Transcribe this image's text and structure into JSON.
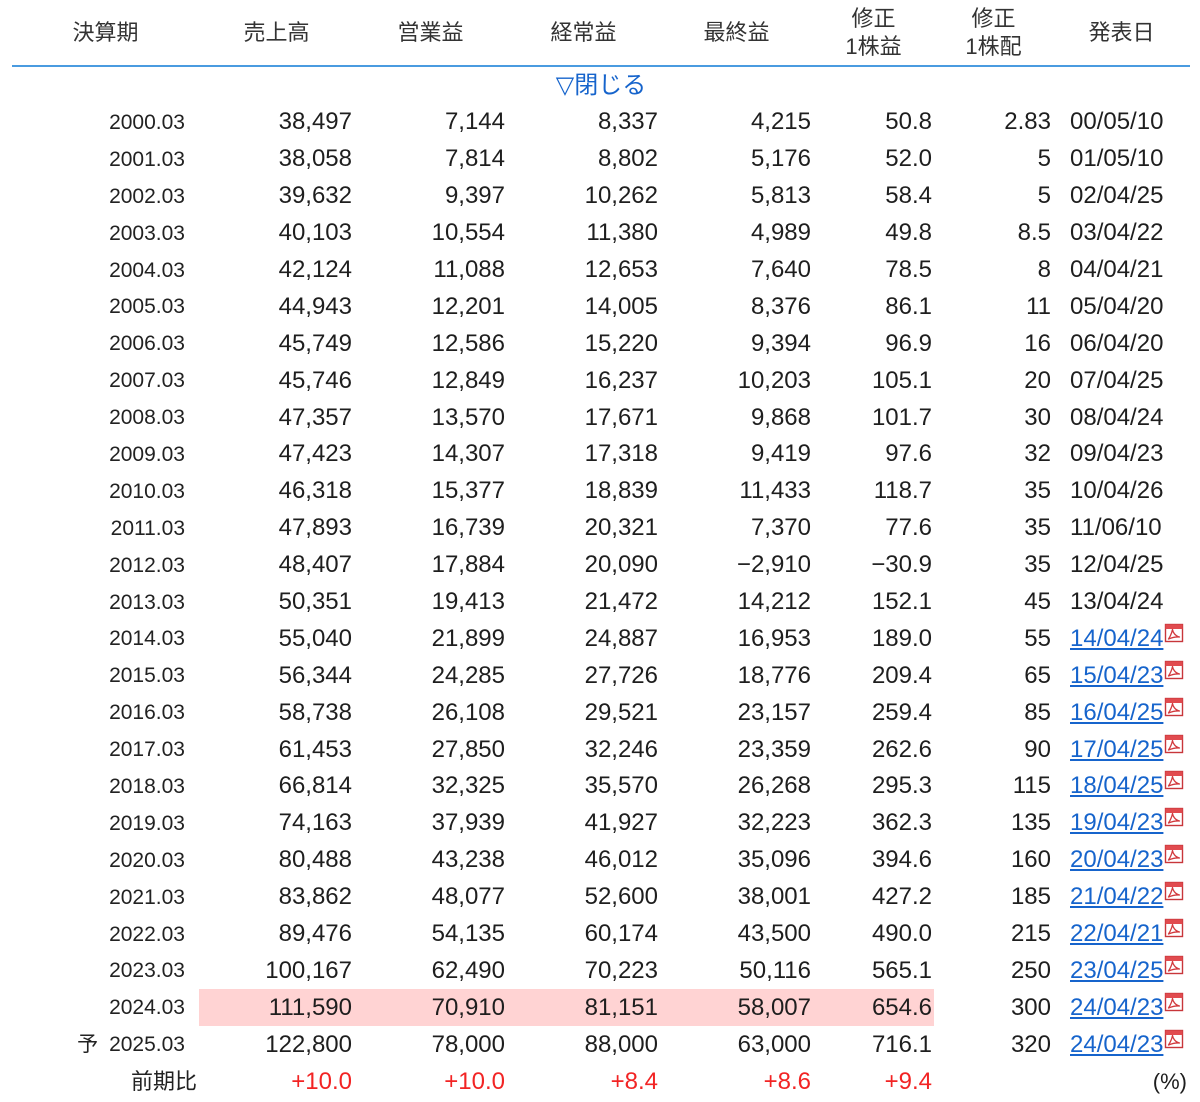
{
  "header": {
    "period": "決算期",
    "sales": "売上高",
    "operating": "営業益",
    "ordinary": "経常益",
    "net": "最終益",
    "eps": {
      "line1": "修正",
      "line2": "1株益"
    },
    "dps": {
      "line1": "修正",
      "line2": "1株配"
    },
    "date": "発表日"
  },
  "toggle": {
    "label": "▽閉じる"
  },
  "rows": [
    {
      "period": "2000.03",
      "sales": "38,497",
      "operating": "7,144",
      "ordinary": "8,337",
      "net": "4,215",
      "eps": "50.8",
      "dps": "2.83",
      "date": "00/05/10",
      "date_link": false
    },
    {
      "period": "2001.03",
      "sales": "38,058",
      "operating": "7,814",
      "ordinary": "8,802",
      "net": "5,176",
      "eps": "52.0",
      "dps": "5",
      "date": "01/05/10",
      "date_link": false
    },
    {
      "period": "2002.03",
      "sales": "39,632",
      "operating": "9,397",
      "ordinary": "10,262",
      "net": "5,813",
      "eps": "58.4",
      "dps": "5",
      "date": "02/04/25",
      "date_link": false
    },
    {
      "period": "2003.03",
      "sales": "40,103",
      "operating": "10,554",
      "ordinary": "11,380",
      "net": "4,989",
      "eps": "49.8",
      "dps": "8.5",
      "date": "03/04/22",
      "date_link": false
    },
    {
      "period": "2004.03",
      "sales": "42,124",
      "operating": "11,088",
      "ordinary": "12,653",
      "net": "7,640",
      "eps": "78.5",
      "dps": "8",
      "date": "04/04/21",
      "date_link": false
    },
    {
      "period": "2005.03",
      "sales": "44,943",
      "operating": "12,201",
      "ordinary": "14,005",
      "net": "8,376",
      "eps": "86.1",
      "dps": "11",
      "date": "05/04/20",
      "date_link": false
    },
    {
      "period": "2006.03",
      "sales": "45,749",
      "operating": "12,586",
      "ordinary": "15,220",
      "net": "9,394",
      "eps": "96.9",
      "dps": "16",
      "date": "06/04/20",
      "date_link": false
    },
    {
      "period": "2007.03",
      "sales": "45,746",
      "operating": "12,849",
      "ordinary": "16,237",
      "net": "10,203",
      "eps": "105.1",
      "dps": "20",
      "date": "07/04/25",
      "date_link": false
    },
    {
      "period": "2008.03",
      "sales": "47,357",
      "operating": "13,570",
      "ordinary": "17,671",
      "net": "9,868",
      "eps": "101.7",
      "dps": "30",
      "date": "08/04/24",
      "date_link": false
    },
    {
      "period": "2009.03",
      "sales": "47,423",
      "operating": "14,307",
      "ordinary": "17,318",
      "net": "9,419",
      "eps": "97.6",
      "dps": "32",
      "date": "09/04/23",
      "date_link": false
    },
    {
      "period": "2010.03",
      "sales": "46,318",
      "operating": "15,377",
      "ordinary": "18,839",
      "net": "11,433",
      "eps": "118.7",
      "dps": "35",
      "date": "10/04/26",
      "date_link": false
    },
    {
      "period": "2011.03",
      "sales": "47,893",
      "operating": "16,739",
      "ordinary": "20,321",
      "net": "7,370",
      "eps": "77.6",
      "dps": "35",
      "date": "11/06/10",
      "date_link": false
    },
    {
      "period": "2012.03",
      "sales": "48,407",
      "operating": "17,884",
      "ordinary": "20,090",
      "net": "−2,910",
      "eps": "−30.9",
      "dps": "35",
      "date": "12/04/25",
      "date_link": false
    },
    {
      "period": "2013.03",
      "sales": "50,351",
      "operating": "19,413",
      "ordinary": "21,472",
      "net": "14,212",
      "eps": "152.1",
      "dps": "45",
      "date": "13/04/24",
      "date_link": false
    },
    {
      "period": "2014.03",
      "sales": "55,040",
      "operating": "21,899",
      "ordinary": "24,887",
      "net": "16,953",
      "eps": "189.0",
      "dps": "55",
      "date": "14/04/24",
      "date_link": true
    },
    {
      "period": "2015.03",
      "sales": "56,344",
      "operating": "24,285",
      "ordinary": "27,726",
      "net": "18,776",
      "eps": "209.4",
      "dps": "65",
      "date": "15/04/23",
      "date_link": true
    },
    {
      "period": "2016.03",
      "sales": "58,738",
      "operating": "26,108",
      "ordinary": "29,521",
      "net": "23,157",
      "eps": "259.4",
      "dps": "85",
      "date": "16/04/25",
      "date_link": true
    },
    {
      "period": "2017.03",
      "sales": "61,453",
      "operating": "27,850",
      "ordinary": "32,246",
      "net": "23,359",
      "eps": "262.6",
      "dps": "90",
      "date": "17/04/25",
      "date_link": true
    },
    {
      "period": "2018.03",
      "sales": "66,814",
      "operating": "32,325",
      "ordinary": "35,570",
      "net": "26,268",
      "eps": "295.3",
      "dps": "115",
      "date": "18/04/25",
      "date_link": true
    },
    {
      "period": "2019.03",
      "sales": "74,163",
      "operating": "37,939",
      "ordinary": "41,927",
      "net": "32,223",
      "eps": "362.3",
      "dps": "135",
      "date": "19/04/23",
      "date_link": true
    },
    {
      "period": "2020.03",
      "sales": "80,488",
      "operating": "43,238",
      "ordinary": "46,012",
      "net": "35,096",
      "eps": "394.6",
      "dps": "160",
      "date": "20/04/23",
      "date_link": true
    },
    {
      "period": "2021.03",
      "sales": "83,862",
      "operating": "48,077",
      "ordinary": "52,600",
      "net": "38,001",
      "eps": "427.2",
      "dps": "185",
      "date": "21/04/22",
      "date_link": true
    },
    {
      "period": "2022.03",
      "sales": "89,476",
      "operating": "54,135",
      "ordinary": "60,174",
      "net": "43,500",
      "eps": "490.0",
      "dps": "215",
      "date": "22/04/21",
      "date_link": true
    },
    {
      "period": "2023.03",
      "sales": "100,167",
      "operating": "62,490",
      "ordinary": "70,223",
      "net": "50,116",
      "eps": "565.1",
      "dps": "250",
      "date": "23/04/25",
      "date_link": true
    },
    {
      "period": "2024.03",
      "sales": "111,590",
      "operating": "70,910",
      "ordinary": "81,151",
      "net": "58,007",
      "eps": "654.6",
      "dps": "300",
      "date": "24/04/23",
      "date_link": true,
      "highlight": true
    }
  ],
  "forecast": {
    "marker": "予",
    "period": "2025.03",
    "sales": "122,800",
    "operating": "78,000",
    "ordinary": "88,000",
    "net": "63,000",
    "eps": "716.1",
    "dps": "320",
    "date": "24/04/23",
    "date_link": true
  },
  "yoy": {
    "label": "前期比",
    "sales": "+10.0",
    "operating": "+10.0",
    "ordinary": "+8.4",
    "net": "+8.6",
    "eps": "+9.4",
    "unit": "(%)"
  },
  "icons": {
    "date_document": "pdf-icon",
    "toggle": "triangle-down-outline-icon"
  },
  "colors": {
    "accent_line": "#4a9be0",
    "link": "#1664cc",
    "highlight": "#ffd3d3",
    "positive": "#f22424",
    "text": "#1e1e1e"
  }
}
